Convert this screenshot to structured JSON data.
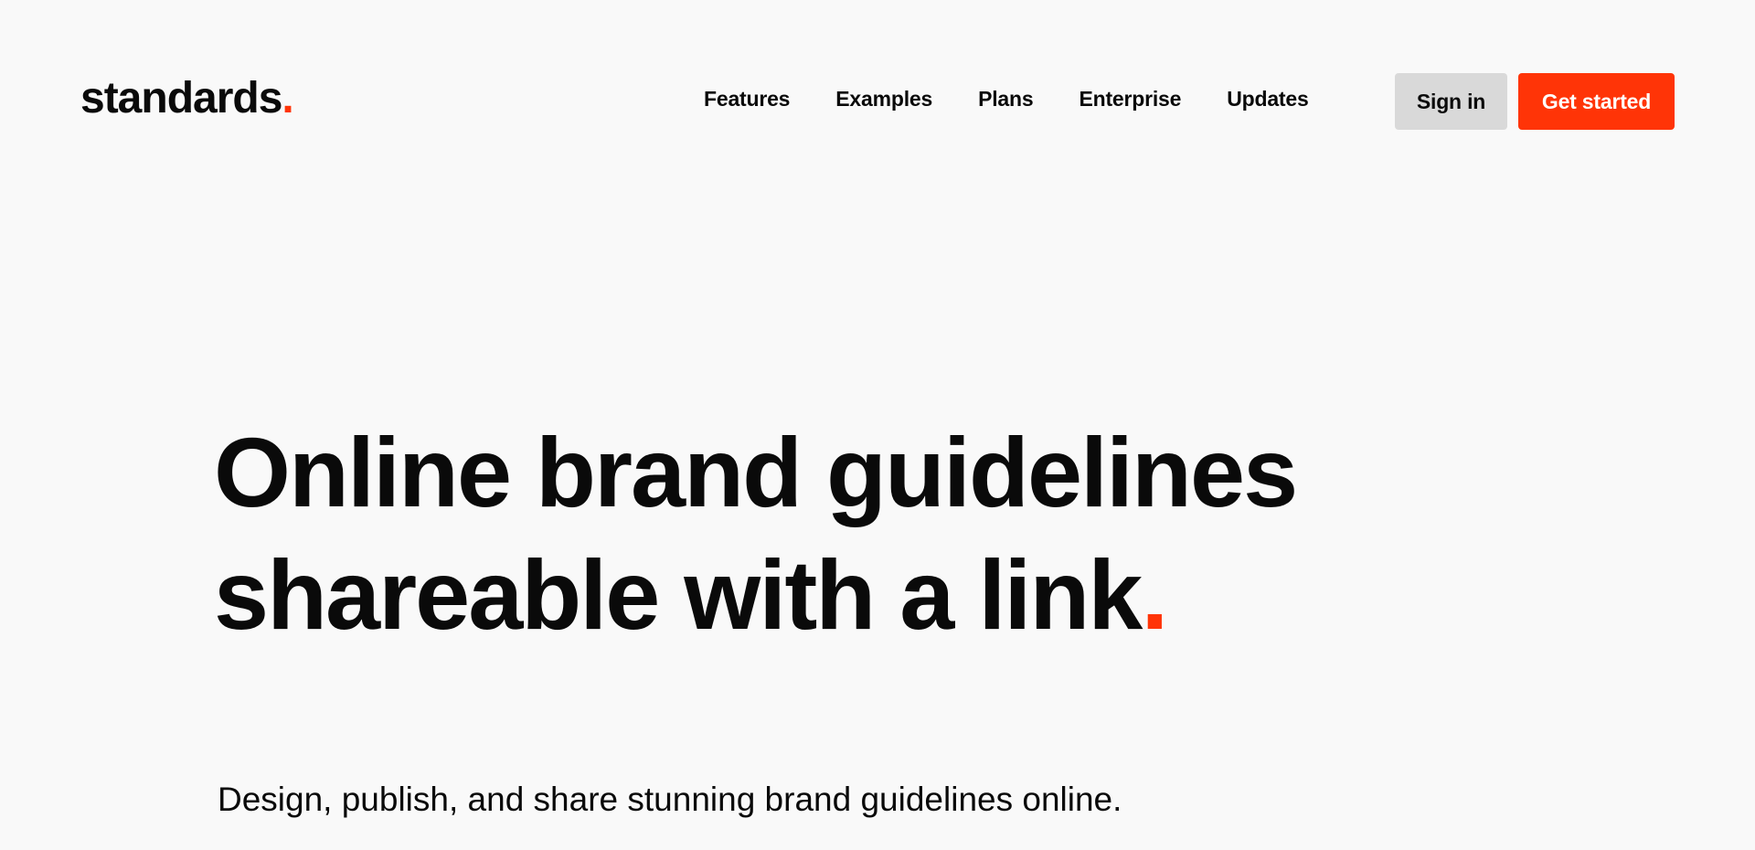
{
  "header": {
    "logo_text": "standards",
    "logo_dot": ".",
    "nav": {
      "features": "Features",
      "examples": "Examples",
      "plans": "Plans",
      "enterprise": "Enterprise",
      "updates": "Updates"
    },
    "sign_in_label": "Sign in",
    "get_started_label": "Get started"
  },
  "hero": {
    "title_line1": "Online brand guidelines",
    "title_line2": "shareable with a link",
    "title_dot": ".",
    "subtitle": "Design, publish, and share stunning brand guidelines online."
  },
  "colors": {
    "accent": "#ff3407",
    "background": "#f9f9f9",
    "text": "#0a0a0a",
    "sign_in_bg": "#d9d9d9"
  }
}
